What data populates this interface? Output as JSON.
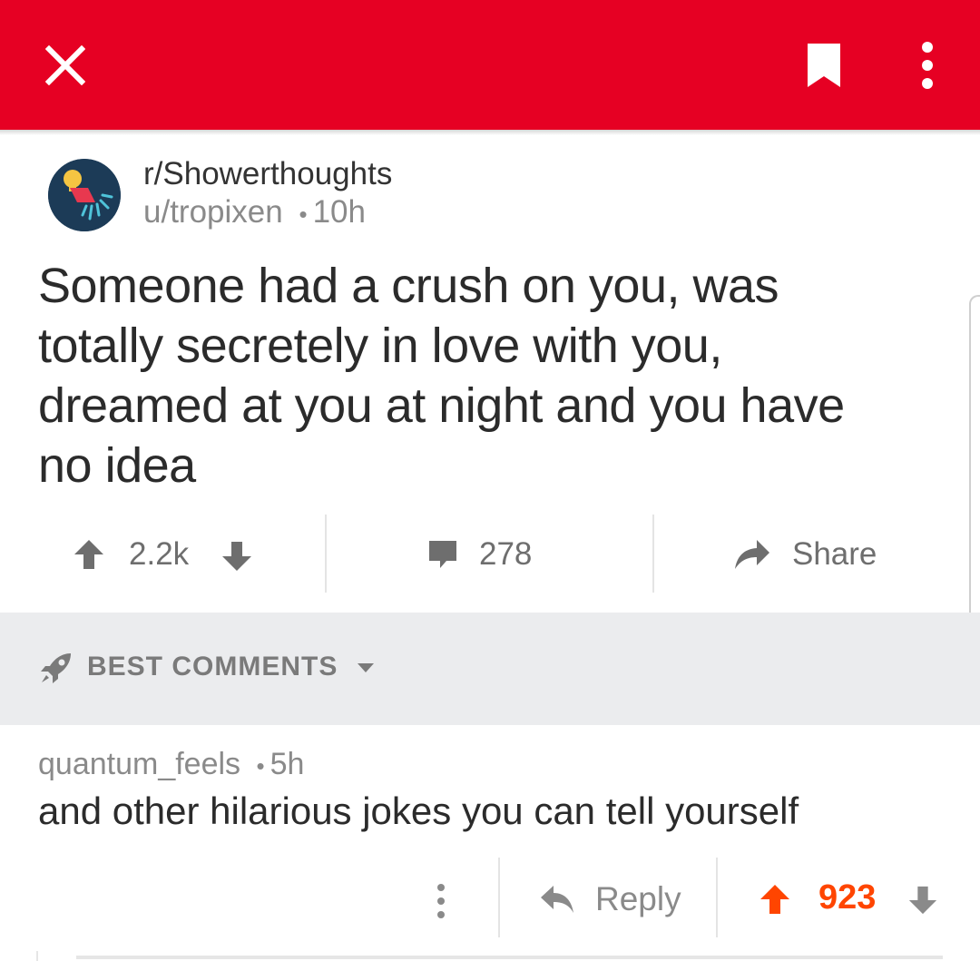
{
  "header": {
    "close_icon": "close-icon",
    "bookmark_icon": "bookmark-icon",
    "more_icon": "more-vertical-icon",
    "color": "#e60023"
  },
  "post": {
    "subreddit": "r/Showerthoughts",
    "author": "u/tropixen",
    "separator": "•",
    "age": "10h",
    "title": "Someone had a crush on you, was totally secretely in love with you, dreamed at you at night and you have no idea",
    "score": "2.2k",
    "comments": "278",
    "share_label": "Share"
  },
  "sort": {
    "label": "BEST COMMENTS",
    "icon": "rocket-icon"
  },
  "comment": {
    "author": "quantum_feels",
    "separator": "•",
    "age": "5h",
    "body": "and other hilarious jokes you can tell yourself",
    "reply_label": "Reply",
    "score": "923",
    "score_color": "#ff4500"
  }
}
